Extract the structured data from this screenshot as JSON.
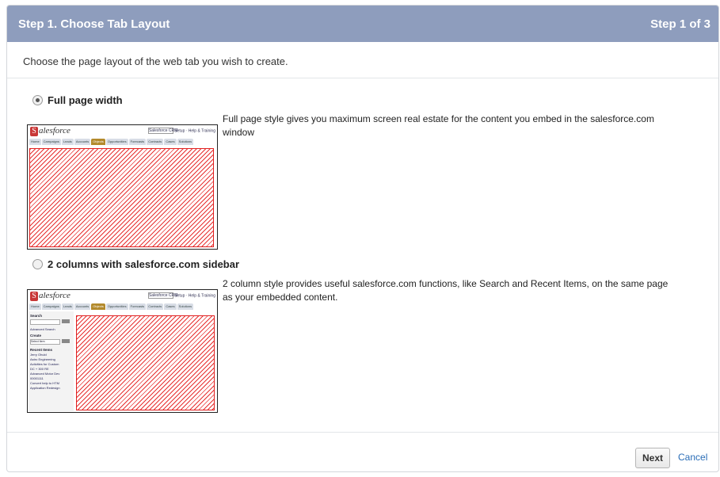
{
  "header": {
    "title": "Step 1. Choose Tab Layout",
    "step": "Step 1 of 3"
  },
  "subtitle": "Choose the page layout of the web tab you wish to create.",
  "options": [
    {
      "label": "Full page width",
      "selected": true,
      "description": "Full page style gives you maximum screen real estate for the content you embed in the salesforce.com window"
    },
    {
      "label": "2 columns with salesforce.com sidebar",
      "selected": false,
      "description": "2 column style provides useful salesforce.com functions, like Search and Recent Items, on the same page as your embedded content."
    }
  ],
  "thumbnail": {
    "logo": "alesforce",
    "search_placeholder": "Salesforce CRM",
    "top_links": "Setup · Help & Training",
    "tabs": [
      "Home",
      "Campaigns",
      "Leads",
      "Accounts",
      "Objects",
      "Opportunities",
      "Forecasts",
      "Contracts",
      "Cases",
      "Solutions"
    ],
    "sidebar": {
      "search_heading": "Search",
      "advanced_search": "Advanced Search",
      "create_heading": "Create",
      "create_select": "Select Item",
      "go": "Go!",
      "recent_heading": "Recent Items",
      "recent_items": [
        "Jerry Ohuld",
        "Astro Engineering",
        "Activities for Custom",
        "DC + 300 RE",
        "Advanced Motor Dev",
        "00001111",
        "Convert help to HTM",
        "Application Redesign"
      ]
    }
  },
  "footer": {
    "next_label": "Next",
    "cancel_label": "Cancel"
  },
  "colors": {
    "header_bg": "#8e9dbd",
    "hatch": "#e83030",
    "link": "#2a6db7"
  }
}
